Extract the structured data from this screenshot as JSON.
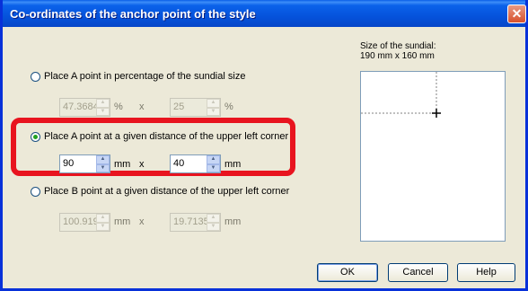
{
  "window": {
    "title": "Co-ordinates of the anchor point of the style",
    "close_glyph": "✕"
  },
  "option1": {
    "label": "Place A point in percentage of the sundial size",
    "x_value": "47.3684",
    "x_unit": "%",
    "separator": "x",
    "y_value": "25",
    "y_unit": "%",
    "selected": false
  },
  "option2": {
    "label": "Place A point at a given distance of the upper left corner",
    "x_value": "90",
    "x_unit": "mm",
    "separator": "x",
    "y_value": "40",
    "y_unit": "mm",
    "selected": true
  },
  "option3": {
    "label": "Place B point at a given distance of the upper left corner",
    "x_value": "100.919",
    "x_unit": "mm",
    "separator": "x",
    "y_value": "19.7135",
    "y_unit": "mm",
    "selected": false
  },
  "preview": {
    "size_label": "Size of the sundial:",
    "size_value": "190 mm x 160 mm"
  },
  "buttons": {
    "ok": "OK",
    "cancel": "Cancel",
    "help": "Help"
  },
  "colors": {
    "highlight": "#e8141f",
    "titlebar": "#0553dc"
  }
}
